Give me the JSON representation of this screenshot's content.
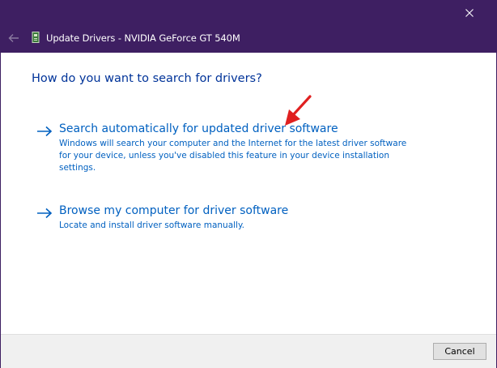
{
  "window": {
    "title": "Update Drivers - NVIDIA GeForce GT 540M"
  },
  "titlebar": {
    "back_icon": "back-arrow-icon",
    "device_icon": "graphics-card-icon",
    "close_icon": "close-icon"
  },
  "content": {
    "heading": "How do you want to search for drivers?",
    "options": [
      {
        "title": "Search automatically for updated driver software",
        "description": "Windows will search your computer and the Internet for the latest driver software for your device, unless you've disabled this feature in your device installation settings.",
        "icon": "right-arrow-icon"
      },
      {
        "title": "Browse my computer for driver software",
        "description": "Locate and install driver software manually.",
        "icon": "right-arrow-icon"
      }
    ],
    "annotation_icon": "red-pointer-arrow-icon"
  },
  "footer": {
    "cancel_label": "Cancel"
  },
  "colors": {
    "titlebar_bg": "#3e1f62",
    "link_blue": "#0060c0",
    "heading_blue": "#003399",
    "annotation_red": "#e02020"
  }
}
